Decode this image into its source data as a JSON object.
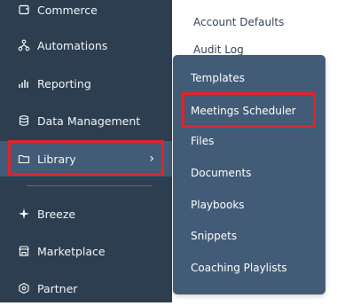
{
  "sidebar": {
    "items": [
      {
        "label": "Commerce",
        "icon": "commerce-icon"
      },
      {
        "label": "Automations",
        "icon": "automations-icon"
      },
      {
        "label": "Reporting",
        "icon": "reporting-icon"
      },
      {
        "label": "Data Management",
        "icon": "database-icon"
      },
      {
        "label": "Library",
        "icon": "folder-icon",
        "active": true
      },
      {
        "label": "Breeze",
        "icon": "sparkle-icon"
      },
      {
        "label": "Marketplace",
        "icon": "store-icon"
      },
      {
        "label": "Partner",
        "icon": "partner-icon"
      }
    ],
    "active_chevron": "›"
  },
  "main": {
    "links": [
      "Account Defaults",
      "Audit Log"
    ]
  },
  "flyout": {
    "items": [
      "Templates",
      "Meetings Scheduler",
      "Files",
      "Documents",
      "Playbooks",
      "Snippets",
      "Coaching Playlists"
    ],
    "highlighted": "Meetings Scheduler"
  },
  "colors": {
    "sidebar_bg": "#2d3e50",
    "flyout_bg": "#425b76",
    "highlight": "#e0242b"
  }
}
